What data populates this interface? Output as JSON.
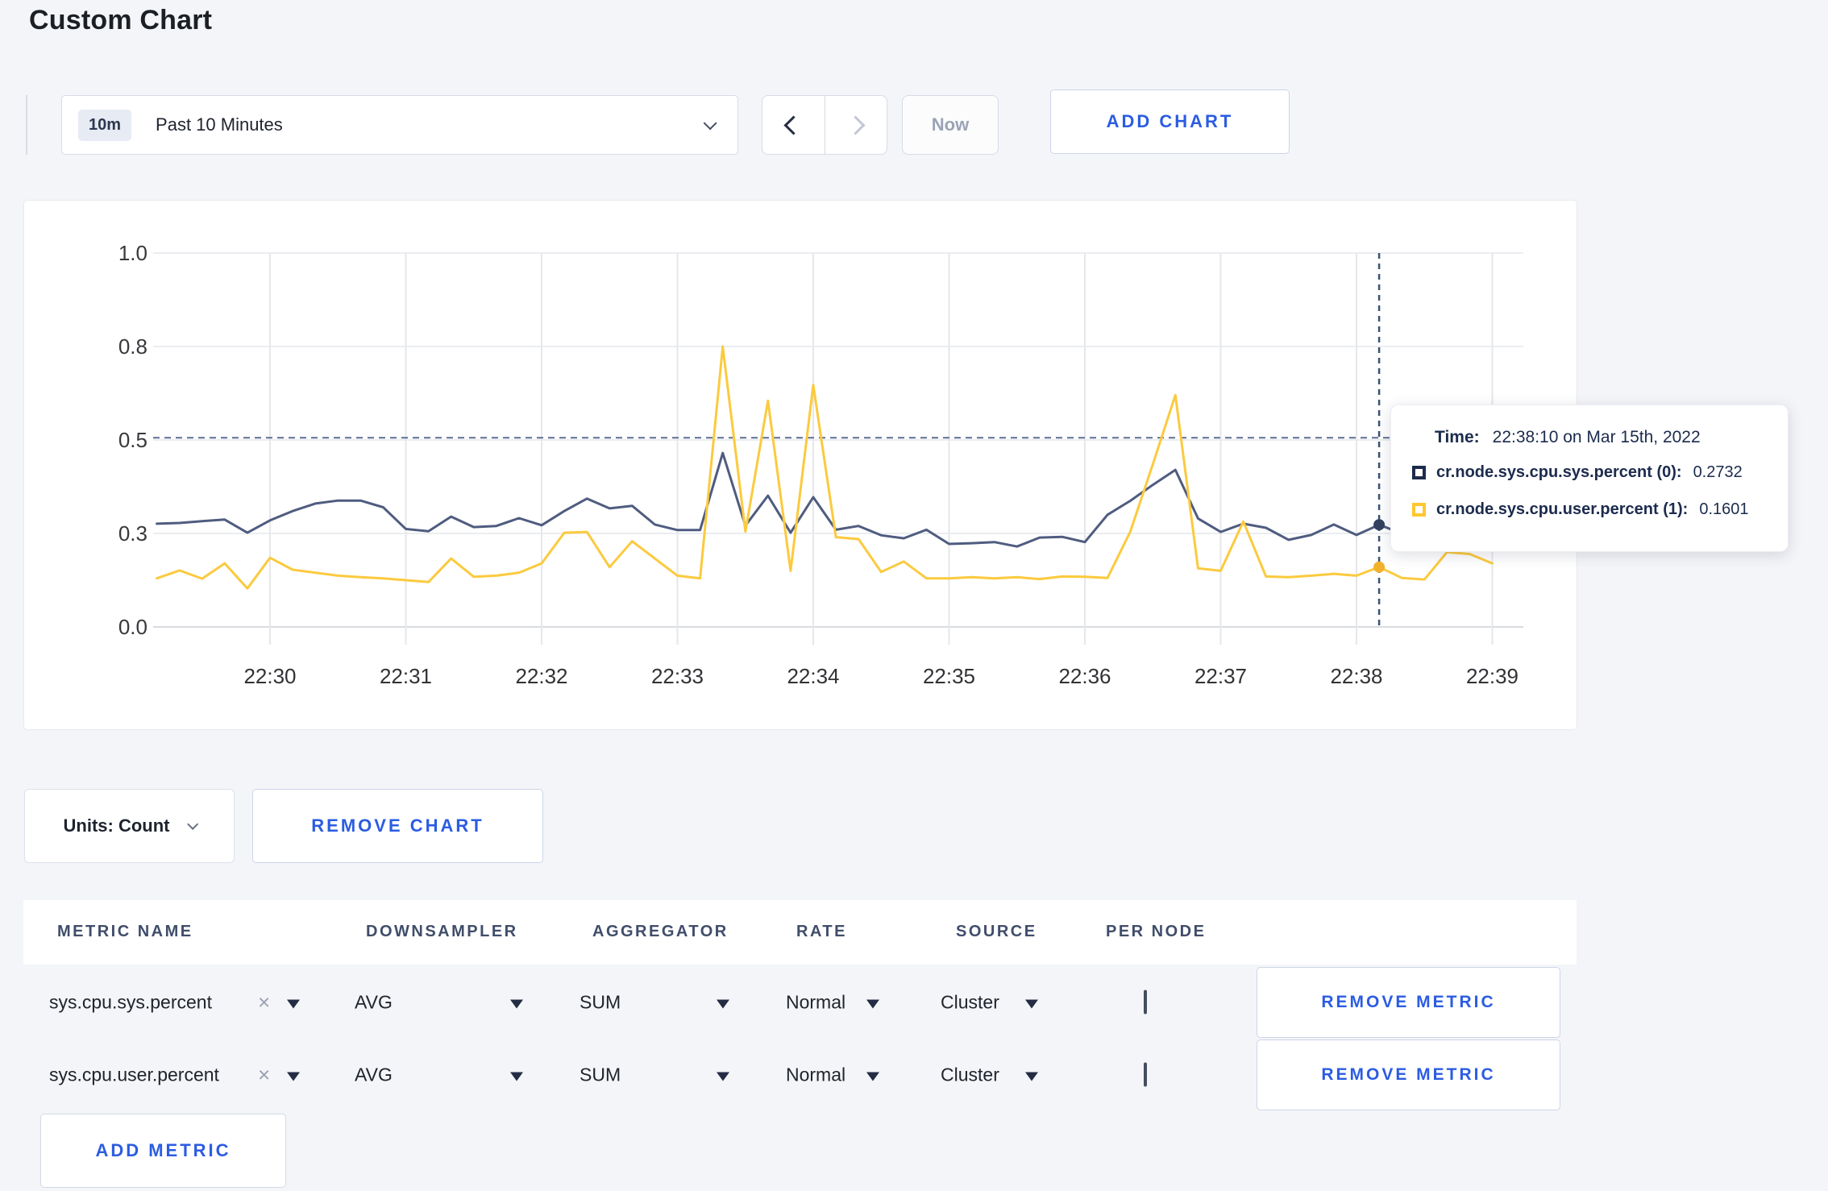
{
  "page": {
    "title": "Custom Chart"
  },
  "toolbar": {
    "time_badge": "10m",
    "time_label": "Past 10 Minutes",
    "now_label": "Now",
    "add_chart_label": "ADD CHART"
  },
  "tooltip": {
    "time_label": "Time:",
    "time_value": "22:38:10 on Mar 15th, 2022",
    "rows": [
      {
        "label": "cr.node.sys.cpu.sys.percent (0):",
        "value": "0.2732",
        "color": "#1c2b4d"
      },
      {
        "label": "cr.node.sys.cpu.user.percent (1):",
        "value": "0.1601",
        "color": "#ffc72e"
      }
    ]
  },
  "units_bar": {
    "units_label": "Units: Count",
    "remove_chart_label": "REMOVE CHART"
  },
  "metrics_table": {
    "headers": [
      "METRIC NAME",
      "DOWNSAMPLER",
      "AGGREGATOR",
      "RATE",
      "SOURCE",
      "PER NODE"
    ],
    "rows": [
      {
        "metric": "sys.cpu.sys.percent",
        "close": "×",
        "downsampler": "AVG",
        "aggregator": "SUM",
        "rate": "Normal",
        "source": "Cluster",
        "per_node_checked": false,
        "remove_label": "REMOVE METRIC"
      },
      {
        "metric": "sys.cpu.user.percent",
        "close": "×",
        "downsampler": "AVG",
        "aggregator": "SUM",
        "rate": "Normal",
        "source": "Cluster",
        "per_node_checked": false,
        "remove_label": "REMOVE METRIC"
      }
    ],
    "add_metric_label": "ADD METRIC"
  },
  "chart_data": {
    "type": "line",
    "title": "",
    "xlabel": "",
    "ylabel": "",
    "ylim": [
      0,
      1
    ],
    "grid": true,
    "legend_position": "tooltip",
    "x_tick_labels": [
      "22:30",
      "22:31",
      "22:32",
      "22:33",
      "22:34",
      "22:35",
      "22:36",
      "22:37",
      "22:38",
      "22:39"
    ],
    "y_tick_values": [
      0,
      0.25,
      0.5,
      0.75,
      1
    ],
    "y_tick_labels": [
      "0.0",
      "0.3",
      "0.5",
      "0.8",
      "1.0"
    ],
    "x_start_time": "22:29:10",
    "x_interval_seconds": 10,
    "threshold_value": 0.506,
    "crosshair_index": 54,
    "crosshair_time": "22:38:10",
    "series": [
      {
        "name": "cr.node.sys.cpu.sys.percent",
        "color": "#4f5c80",
        "dot_color": "#33425f",
        "values": [
          0.276,
          0.278,
          0.283,
          0.287,
          0.252,
          0.285,
          0.31,
          0.33,
          0.338,
          0.338,
          0.32,
          0.262,
          0.256,
          0.295,
          0.267,
          0.27,
          0.291,
          0.272,
          0.31,
          0.343,
          0.317,
          0.324,
          0.274,
          0.259,
          0.259,
          0.465,
          0.271,
          0.351,
          0.252,
          0.347,
          0.26,
          0.27,
          0.245,
          0.237,
          0.26,
          0.222,
          0.224,
          0.227,
          0.215,
          0.239,
          0.241,
          0.227,
          0.3,
          0.337,
          0.38,
          0.42,
          0.29,
          0.254,
          0.276,
          0.265,
          0.233,
          0.246,
          0.274,
          0.246,
          0.2732,
          0.25,
          null,
          null,
          null,
          null
        ]
      },
      {
        "name": "cr.node.sys.cpu.user.percent",
        "color": "#fbca3e",
        "dot_color": "#f2b12c",
        "values": [
          0.13,
          0.151,
          0.129,
          0.17,
          0.103,
          0.185,
          0.153,
          0.145,
          0.137,
          0.133,
          0.13,
          0.125,
          0.12,
          0.183,
          0.134,
          0.137,
          0.145,
          0.17,
          0.252,
          0.254,
          0.16,
          0.229,
          0.183,
          0.137,
          0.13,
          0.75,
          0.255,
          0.605,
          0.15,
          0.647,
          0.24,
          0.235,
          0.147,
          0.175,
          0.13,
          0.13,
          0.133,
          0.13,
          0.133,
          0.128,
          0.135,
          0.134,
          0.131,
          0.254,
          0.435,
          0.62,
          0.157,
          0.15,
          0.282,
          0.135,
          0.133,
          0.137,
          0.142,
          0.137,
          0.1601,
          0.131,
          0.127,
          0.2,
          0.195,
          0.17
        ]
      }
    ]
  }
}
